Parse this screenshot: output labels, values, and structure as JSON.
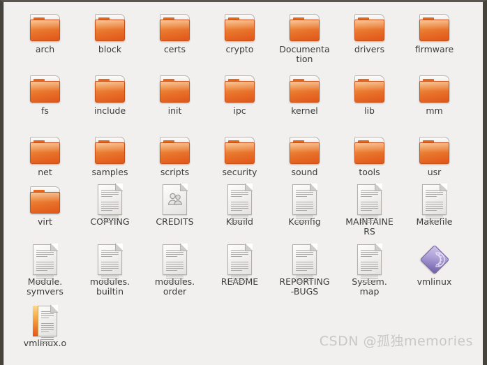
{
  "window": {
    "background_color": "#f1f0ee",
    "frame_color": "#46423c"
  },
  "file_manager": {
    "view": "icon-grid",
    "columns": 7,
    "items": [
      {
        "name": "arch",
        "label": "arch",
        "type": "folder",
        "icon": "folder-icon",
        "row": 0,
        "col": 0
      },
      {
        "name": "block",
        "label": "block",
        "type": "folder",
        "icon": "folder-icon",
        "row": 0,
        "col": 1
      },
      {
        "name": "certs",
        "label": "certs",
        "type": "folder",
        "icon": "folder-icon",
        "row": 0,
        "col": 2
      },
      {
        "name": "crypto",
        "label": "crypto",
        "type": "folder",
        "icon": "folder-icon",
        "row": 0,
        "col": 3
      },
      {
        "name": "Documentation",
        "label": "Documenta\ntion",
        "type": "folder",
        "icon": "folder-icon",
        "row": 0,
        "col": 4
      },
      {
        "name": "drivers",
        "label": "drivers",
        "type": "folder",
        "icon": "folder-icon",
        "row": 0,
        "col": 5
      },
      {
        "name": "firmware",
        "label": "firmware",
        "type": "folder",
        "icon": "folder-icon",
        "row": 0,
        "col": 6
      },
      {
        "name": "fs",
        "label": "fs",
        "type": "folder",
        "icon": "folder-icon",
        "row": 1,
        "col": 0
      },
      {
        "name": "include",
        "label": "include",
        "type": "folder",
        "icon": "folder-icon",
        "row": 1,
        "col": 1
      },
      {
        "name": "init",
        "label": "init",
        "type": "folder",
        "icon": "folder-icon",
        "row": 1,
        "col": 2
      },
      {
        "name": "ipc",
        "label": "ipc",
        "type": "folder",
        "icon": "folder-icon",
        "row": 1,
        "col": 3
      },
      {
        "name": "kernel",
        "label": "kernel",
        "type": "folder",
        "icon": "folder-icon",
        "row": 1,
        "col": 4
      },
      {
        "name": "lib",
        "label": "lib",
        "type": "folder",
        "icon": "folder-icon",
        "row": 1,
        "col": 5
      },
      {
        "name": "mm",
        "label": "mm",
        "type": "folder",
        "icon": "folder-icon",
        "row": 1,
        "col": 6
      },
      {
        "name": "net",
        "label": "net",
        "type": "folder",
        "icon": "folder-icon",
        "row": 2,
        "col": 0
      },
      {
        "name": "samples",
        "label": "samples",
        "type": "folder",
        "icon": "folder-icon",
        "row": 2,
        "col": 1
      },
      {
        "name": "scripts",
        "label": "scripts",
        "type": "folder",
        "icon": "folder-icon",
        "row": 2,
        "col": 2
      },
      {
        "name": "security",
        "label": "security",
        "type": "folder",
        "icon": "folder-icon",
        "row": 2,
        "col": 3
      },
      {
        "name": "sound",
        "label": "sound",
        "type": "folder",
        "icon": "folder-icon",
        "row": 2,
        "col": 4
      },
      {
        "name": "tools",
        "label": "tools",
        "type": "folder",
        "icon": "folder-icon",
        "row": 2,
        "col": 5
      },
      {
        "name": "usr",
        "label": "usr",
        "type": "folder",
        "icon": "folder-icon",
        "row": 2,
        "col": 6
      },
      {
        "name": "virt",
        "label": "virt",
        "type": "folder",
        "icon": "folder-icon",
        "row": 3,
        "col": 0
      },
      {
        "name": "COPYING",
        "label": "COPYING",
        "type": "document",
        "icon": "text-document-icon",
        "row": 3,
        "col": 1
      },
      {
        "name": "CREDITS",
        "label": "CREDITS",
        "type": "document",
        "icon": "contacts-document-icon",
        "row": 3,
        "col": 2
      },
      {
        "name": "Kbuild",
        "label": "Kbuild",
        "type": "document",
        "icon": "text-document-icon",
        "row": 3,
        "col": 3
      },
      {
        "name": "Kconfig",
        "label": "Kconfig",
        "type": "document",
        "icon": "text-document-icon",
        "row": 3,
        "col": 4
      },
      {
        "name": "MAINTAINERS",
        "label": "MAINTAINE\nRS",
        "type": "document",
        "icon": "text-document-icon",
        "row": 3,
        "col": 5
      },
      {
        "name": "Makefile",
        "label": "Makefile",
        "type": "document",
        "icon": "text-document-icon",
        "row": 3,
        "col": 6
      },
      {
        "name": "Module.symvers",
        "label": "Module.\nsymvers",
        "type": "document",
        "icon": "text-document-icon",
        "row": 4,
        "col": 0
      },
      {
        "name": "modules.builtin",
        "label": "modules.\nbuiltin",
        "type": "document",
        "icon": "text-document-icon",
        "row": 4,
        "col": 1
      },
      {
        "name": "modules.order",
        "label": "modules.\norder",
        "type": "document",
        "icon": "text-document-icon",
        "row": 4,
        "col": 2
      },
      {
        "name": "README",
        "label": "README",
        "type": "document",
        "icon": "text-document-icon",
        "row": 4,
        "col": 3
      },
      {
        "name": "REPORTING-BUGS",
        "label": "REPORTING\n-BUGS",
        "type": "document",
        "icon": "text-document-icon",
        "row": 4,
        "col": 4
      },
      {
        "name": "System.map",
        "label": "System.\nmap",
        "type": "document",
        "icon": "text-document-icon",
        "row": 4,
        "col": 5
      },
      {
        "name": "vmlinux",
        "label": "vmlinux",
        "type": "executable",
        "icon": "executable-icon",
        "row": 4,
        "col": 6
      },
      {
        "name": "vmlinux.o",
        "label": "vmlinux.o",
        "type": "object",
        "icon": "object-file-icon",
        "row": 5,
        "col": 0
      }
    ]
  },
  "watermark": {
    "text": "CSDN @孤独memories"
  }
}
